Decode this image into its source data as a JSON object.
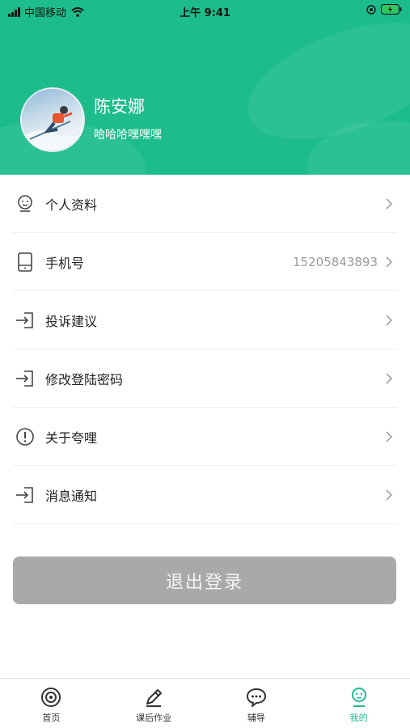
{
  "status_bar": {
    "carrier": "中国移动",
    "time": "上午 9:41"
  },
  "profile": {
    "name": "陈安娜",
    "signature": "哈哈哈嘿嘿嘿"
  },
  "menu": [
    {
      "label": "个人资料",
      "value": "",
      "icon": "face-icon"
    },
    {
      "label": "手机号",
      "value": "15205843893",
      "icon": "phone-icon"
    },
    {
      "label": "投诉建议",
      "value": "",
      "icon": "enter-icon"
    },
    {
      "label": "修改登陆密码",
      "value": "",
      "icon": "enter-icon"
    },
    {
      "label": "关于夸哩",
      "value": "",
      "icon": "info-icon"
    },
    {
      "label": "消息通知",
      "value": "",
      "icon": "enter-icon"
    }
  ],
  "logout_label": "退出登录",
  "tabs": [
    {
      "label": "首页",
      "icon": "home-icon",
      "active": false
    },
    {
      "label": "课后作业",
      "icon": "homework-icon",
      "active": false
    },
    {
      "label": "辅导",
      "icon": "tutor-icon",
      "active": false
    },
    {
      "label": "我的",
      "icon": "profile-icon",
      "active": true
    }
  ],
  "colors": {
    "brand": "#1dbd8b",
    "logout_bg": "#a9a9a9"
  }
}
